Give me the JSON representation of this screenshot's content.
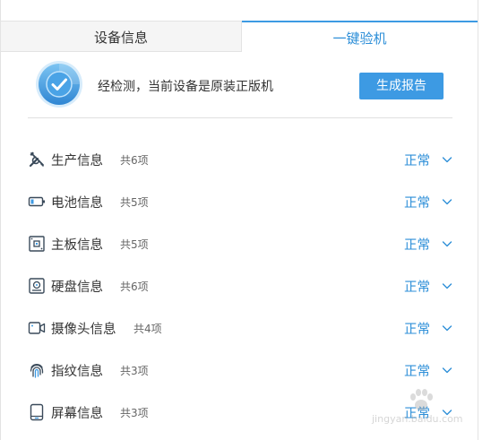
{
  "tabs": [
    {
      "label": "设备信息",
      "active": false
    },
    {
      "label": "一键验机",
      "active": true
    }
  ],
  "result": {
    "message": "经检测，当前设备是原装正版机",
    "report_button": "生成报告"
  },
  "items": [
    {
      "title": "生产信息",
      "count": "共6项",
      "status": "正常",
      "icon": "tools-icon"
    },
    {
      "title": "电池信息",
      "count": "共5项",
      "status": "正常",
      "icon": "battery-icon"
    },
    {
      "title": "主板信息",
      "count": "共5项",
      "status": "正常",
      "icon": "motherboard-icon"
    },
    {
      "title": "硬盘信息",
      "count": "共6项",
      "status": "正常",
      "icon": "disk-icon"
    },
    {
      "title": "摄像头信息",
      "count": "共4项",
      "status": "正常",
      "icon": "camera-icon"
    },
    {
      "title": "指纹信息",
      "count": "共3项",
      "status": "正常",
      "icon": "fingerprint-icon"
    },
    {
      "title": "屏幕信息",
      "count": "共3项",
      "status": "正常",
      "icon": "screen-icon"
    }
  ],
  "colors": {
    "accent": "#3d9ae3",
    "status_text": "#2e8fd8",
    "tab_inactive_bg": "#f5f5f5"
  },
  "watermark": {
    "text": "jingyan.baidu.com"
  }
}
